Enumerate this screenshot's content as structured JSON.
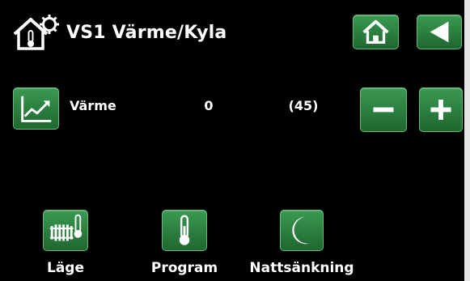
{
  "header": {
    "title": "VS1 Värme/Kyla",
    "title_icon": "house-thermometer-gear-icon",
    "home_icon": "house-icon",
    "back_icon": "back-arrow-icon"
  },
  "row": {
    "icon": "chart-icon",
    "label": "Värme",
    "value": "0",
    "setpoint": "(45)",
    "minus_icon": "minus-icon",
    "plus_icon": "plus-icon"
  },
  "bottom": {
    "items": [
      {
        "label": "Läge",
        "icon": "radiator-thermometer-icon"
      },
      {
        "label": "Program",
        "icon": "thermometer-icon"
      },
      {
        "label": "Nattsänkning",
        "icon": "moon-icon"
      }
    ]
  },
  "colors": {
    "background": "#000000",
    "button_green": "#2e8544",
    "text": "#ffffff"
  }
}
